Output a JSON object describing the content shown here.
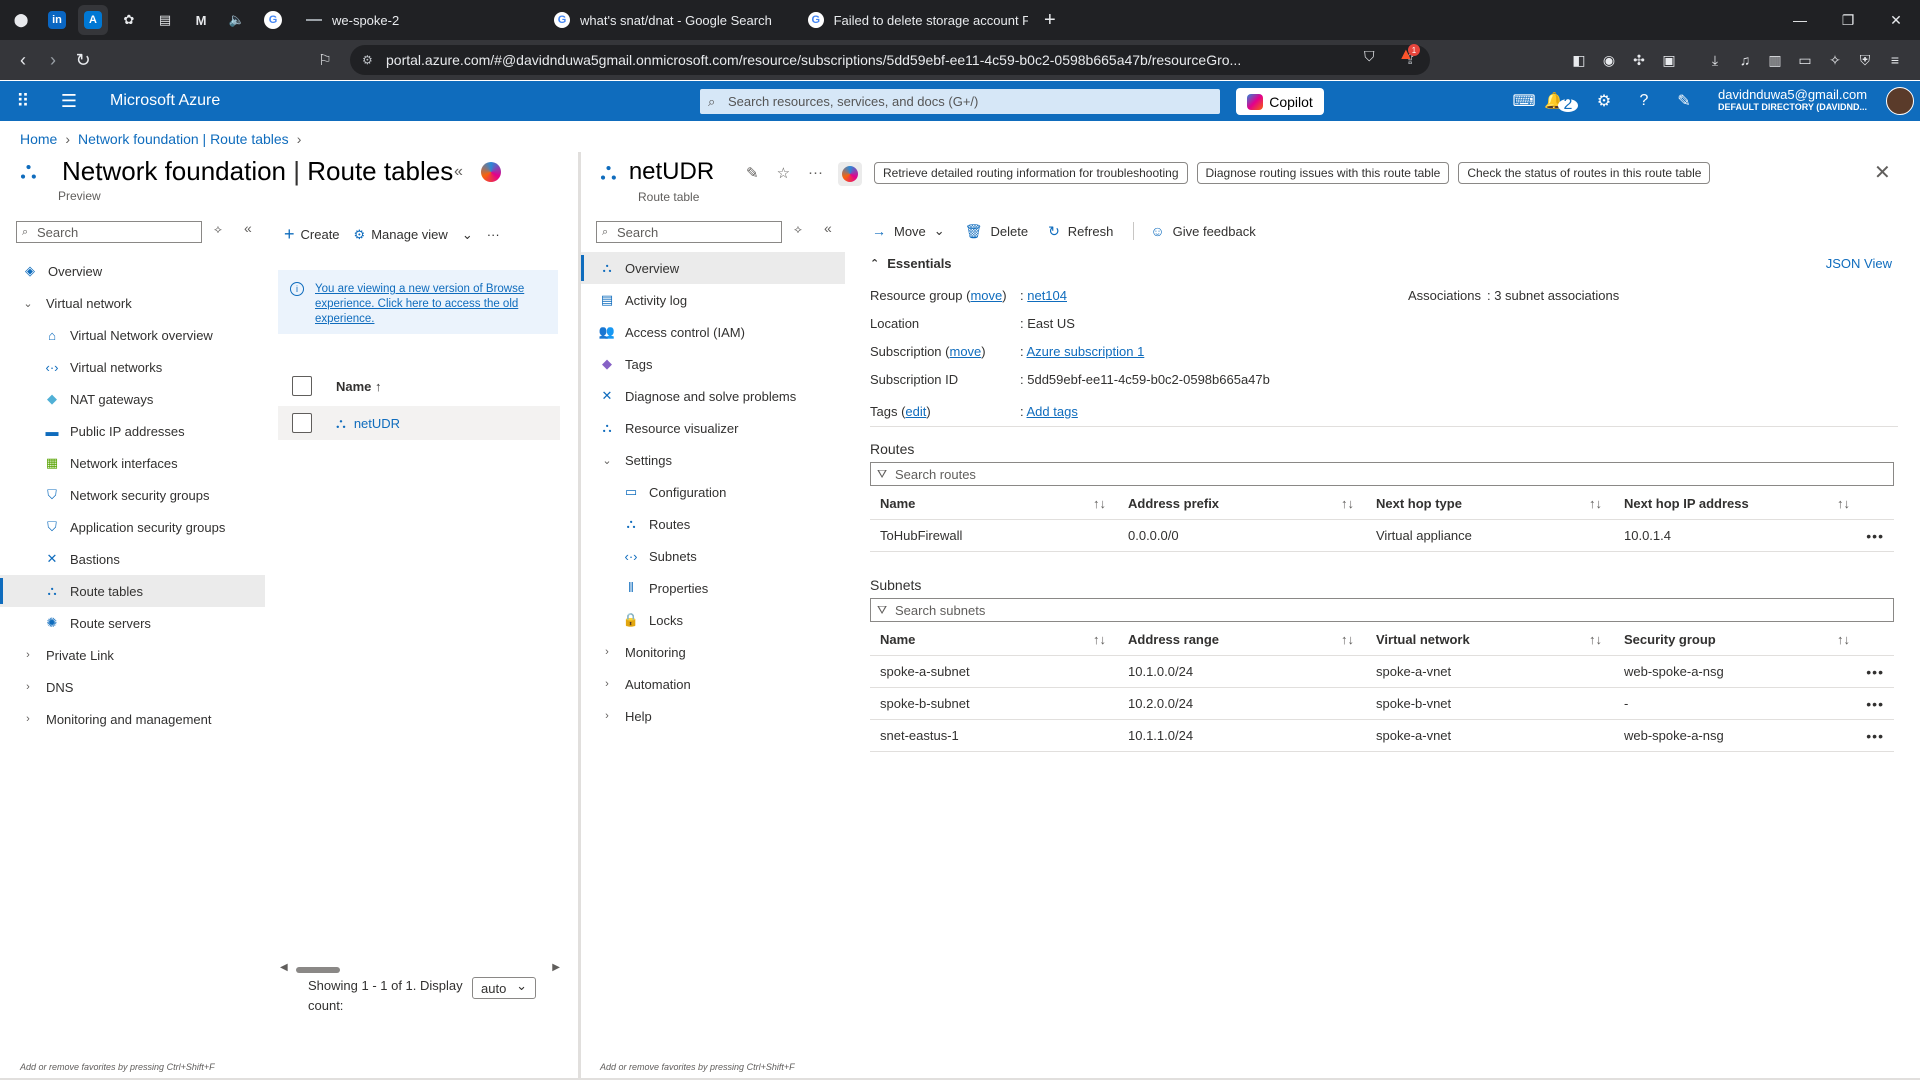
{
  "browser": {
    "tabs": [
      {
        "title": "we-spoke-2"
      },
      {
        "title": "what's snat/dnat - Google Search"
      },
      {
        "title": "Failed to delete storage account Faile"
      }
    ],
    "url": "portal.azure.com/#@davidnduwa5gmail.onmicrosoft.com/resource/subscriptions/5dd59ebf-ee11-4c59-b0c2-0598b665a47b/resourceGro...",
    "ext_badge": "1"
  },
  "azure_header": {
    "brand": "Microsoft Azure",
    "search_placeholder": "Search resources, services, and docs (G+/)",
    "copilot": "Copilot",
    "notif_count": "2",
    "user_email": "davidnduwa5@gmail.com",
    "user_directory": "DEFAULT DIRECTORY (DAVIDND..."
  },
  "breadcrumb": [
    "Home",
    "Network foundation | Route tables"
  ],
  "left_blade": {
    "title_main": "Network foundation",
    "title_sub": "Route tables",
    "preview": "Preview",
    "search_placeholder": "Search",
    "nav": [
      {
        "label": "Overview",
        "level": 0
      },
      {
        "label": "Virtual network",
        "level": 0,
        "expanded": true
      },
      {
        "label": "Virtual Network overview",
        "level": 1
      },
      {
        "label": "Virtual networks",
        "level": 1
      },
      {
        "label": "NAT gateways",
        "level": 1
      },
      {
        "label": "Public IP addresses",
        "level": 1
      },
      {
        "label": "Network interfaces",
        "level": 1
      },
      {
        "label": "Network security groups",
        "level": 1
      },
      {
        "label": "Application security groups",
        "level": 1
      },
      {
        "label": "Bastions",
        "level": 1
      },
      {
        "label": "Route tables",
        "level": 1,
        "selected": true
      },
      {
        "label": "Route servers",
        "level": 1
      },
      {
        "label": "Private Link",
        "level": 0,
        "expanded": false
      },
      {
        "label": "DNS",
        "level": 0,
        "expanded": false
      },
      {
        "label": "Monitoring and management",
        "level": 0,
        "expanded": false
      }
    ],
    "toolbar": {
      "create": "Create",
      "manage_view": "Manage view"
    },
    "info_text": "You are viewing a new version of Browse experience. Click here to access the old experience.",
    "list_header": "Name ↑",
    "list_items": [
      "netUDR"
    ],
    "showing": "Showing 1 - 1 of 1. Display count:",
    "display_count": "auto",
    "fav_hint": "Add or remove favorites by pressing Ctrl+Shift+F"
  },
  "resource": {
    "name": "netUDR",
    "type": "Route table",
    "chips": [
      "Retrieve detailed routing information for troubleshooting",
      "Diagnose routing issues with this route table",
      "Check the status of routes in this route table"
    ],
    "search_placeholder": "Search",
    "menu": [
      {
        "label": "Overview",
        "selected": true
      },
      {
        "label": "Activity log"
      },
      {
        "label": "Access control (IAM)"
      },
      {
        "label": "Tags"
      },
      {
        "label": "Diagnose and solve problems"
      },
      {
        "label": "Resource visualizer"
      },
      {
        "label": "Settings",
        "group": true,
        "expanded": true
      },
      {
        "label": "Configuration",
        "sub": true
      },
      {
        "label": "Routes",
        "sub": true
      },
      {
        "label": "Subnets",
        "sub": true
      },
      {
        "label": "Properties",
        "sub": true
      },
      {
        "label": "Locks",
        "sub": true
      },
      {
        "label": "Monitoring",
        "group": true,
        "expanded": false
      },
      {
        "label": "Automation",
        "group": true,
        "expanded": false
      },
      {
        "label": "Help",
        "group": true,
        "expanded": false
      }
    ],
    "commands": {
      "move": "Move",
      "delete": "Delete",
      "refresh": "Refresh",
      "feedback": "Give feedback"
    },
    "essentials": {
      "title": "Essentials",
      "json_view": "JSON View",
      "resource_group_label": "Resource group",
      "move": "move",
      "resource_group": "net104",
      "location_label": "Location",
      "location": "East US",
      "subscription_label": "Subscription",
      "subscription": "Azure subscription 1",
      "subscription_id_label": "Subscription ID",
      "subscription_id": "5dd59ebf-ee11-4c59-b0c2-0598b665a47b",
      "tags_label": "Tags",
      "edit": "edit",
      "add_tags": "Add tags",
      "associations_label": "Associations",
      "associations": "3 subnet associations"
    },
    "routes": {
      "title": "Routes",
      "search_placeholder": "Search routes",
      "columns": [
        "Name",
        "Address prefix",
        "Next hop type",
        "Next hop IP address"
      ],
      "rows": [
        [
          "ToHubFirewall",
          "0.0.0.0/0",
          "Virtual appliance",
          "10.0.1.4"
        ]
      ]
    },
    "subnets": {
      "title": "Subnets",
      "search_placeholder": "Search subnets",
      "columns": [
        "Name",
        "Address range",
        "Virtual network",
        "Security group"
      ],
      "rows": [
        [
          "spoke-a-subnet",
          "10.1.0.0/24",
          "spoke-a-vnet",
          "web-spoke-a-nsg"
        ],
        [
          "spoke-b-subnet",
          "10.2.0.0/24",
          "spoke-b-vnet",
          "-"
        ],
        [
          "snet-eastus-1",
          "10.1.1.0/24",
          "spoke-a-vnet",
          "web-spoke-a-nsg"
        ]
      ]
    },
    "fav_hint": "Add or remove favorites by pressing Ctrl+Shift+F"
  }
}
